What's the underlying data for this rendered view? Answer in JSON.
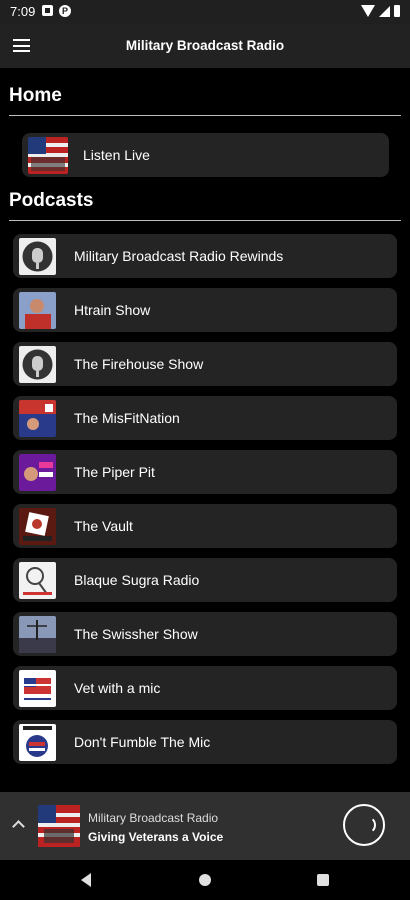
{
  "status_bar": {
    "time": "7:09"
  },
  "app_bar": {
    "title": "Military Broadcast Radio"
  },
  "home": {
    "heading": "Home",
    "items": [
      {
        "label": "Listen Live",
        "icon": "flag-art-thumbnail"
      }
    ]
  },
  "podcasts": {
    "heading": "Podcasts",
    "items": [
      {
        "label": "Military Broadcast Radio Rewinds",
        "icon": "microphone-logo-thumbnail"
      },
      {
        "label": "Htrain Show",
        "icon": "host-photo-thumbnail"
      },
      {
        "label": "The Firehouse Show",
        "icon": "microphone-logo-thumbnail"
      },
      {
        "label": "The MisFitNation",
        "icon": "host-photo-thumbnail"
      },
      {
        "label": "The Piper Pit",
        "icon": "host-photo-thumbnail"
      },
      {
        "label": "The Vault",
        "icon": "vault-logo-thumbnail"
      },
      {
        "label": "Blaque Sugra Radio",
        "icon": "microphone-sketch-thumbnail"
      },
      {
        "label": "The Swissher Show",
        "icon": "landscape-thumbnail"
      },
      {
        "label": "Vet with a mic",
        "icon": "flag-logo-thumbnail"
      },
      {
        "label": "Don't Fumble The Mic",
        "icon": "flag-logo-thumbnail"
      }
    ]
  },
  "player": {
    "title": "Military Broadcast Radio",
    "subtitle": "Giving Veterans a Voice"
  }
}
